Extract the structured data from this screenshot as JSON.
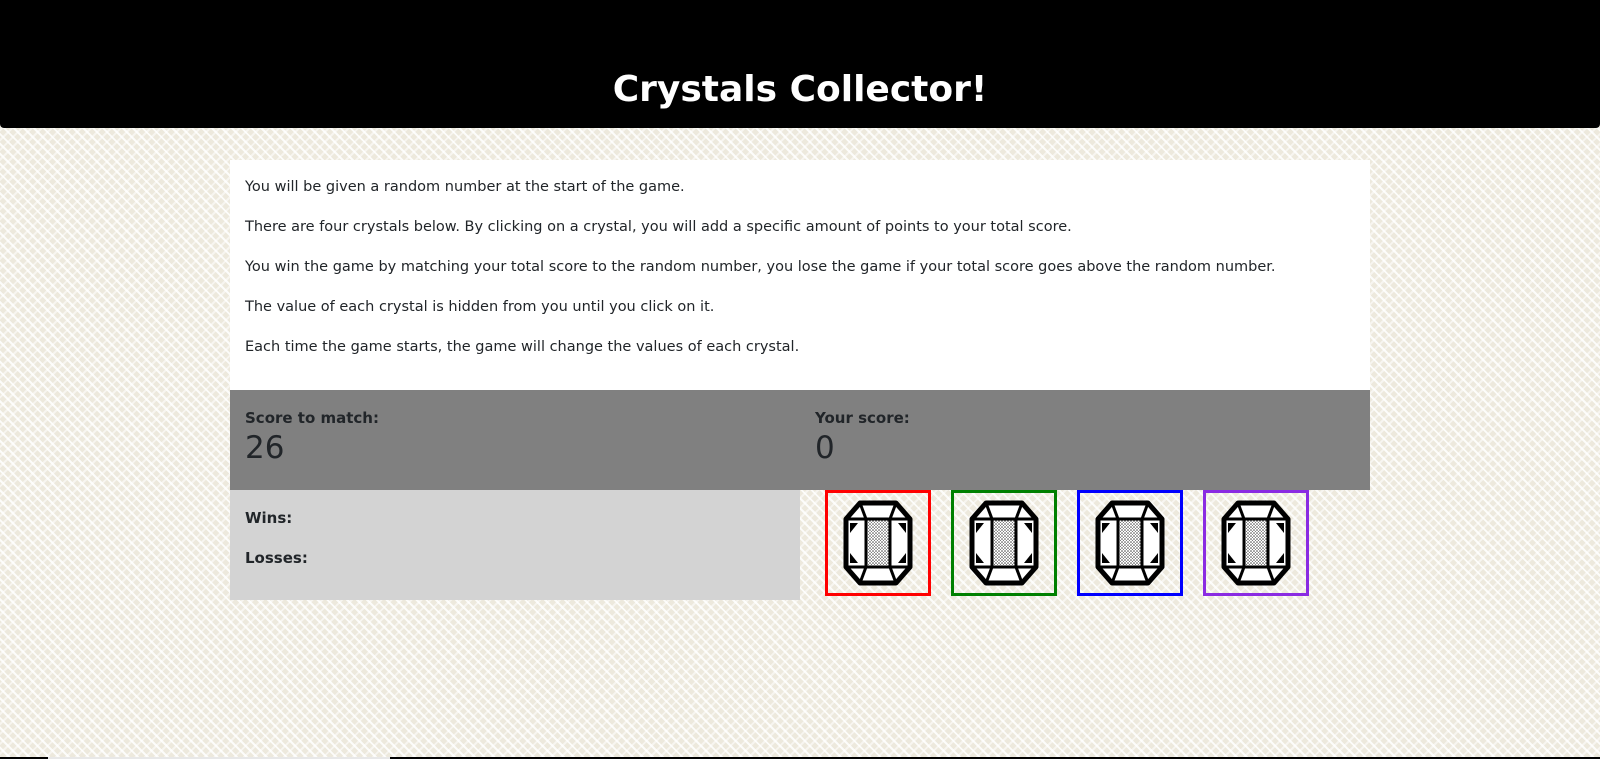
{
  "header": {
    "title": "Crystals Collector!"
  },
  "instructions": [
    "You will be given a random number at the start of the game.",
    "There are four crystals below. By clicking on a crystal, you will add a specific amount of points to your total score.",
    "You win the game by matching your total score to the random number, you lose the game if your total score goes above the random number.",
    "The value of each crystal is hidden from you until you click on it.",
    "Each time the game starts, the game will change the values of each crystal."
  ],
  "scores": {
    "target_label": "Score to match:",
    "target_value": "26",
    "user_label": "Your score:",
    "user_value": "0"
  },
  "record": {
    "wins_label": "Wins:",
    "losses_label": "Losses:"
  },
  "crystals": [
    {
      "icon": "crystal-gem-icon",
      "border_color": "#ff0000"
    },
    {
      "icon": "crystal-gem-icon",
      "border_color": "#008000"
    },
    {
      "icon": "crystal-gem-icon",
      "border_color": "#0000ff"
    },
    {
      "icon": "crystal-gem-icon",
      "border_color": "#8a2be2"
    }
  ]
}
